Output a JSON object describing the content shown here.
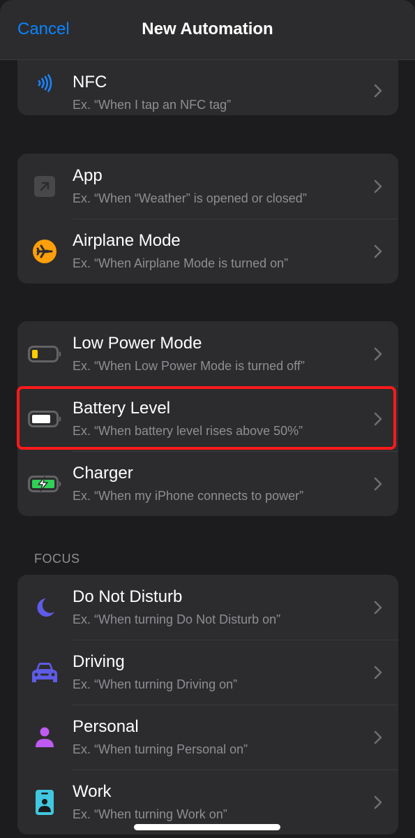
{
  "navbar": {
    "cancel_label": "Cancel",
    "title": "New Automation"
  },
  "colors": {
    "accent": "#0a84ff",
    "background": "#1c1c1e",
    "card": "#2c2c2e",
    "highlight_border": "#ff1a1a"
  },
  "groups": [
    {
      "items": [
        {
          "icon": "nfc-icon",
          "title": "NFC",
          "subtitle": "Ex. “When I tap an NFC tag”"
        }
      ]
    },
    {
      "items": [
        {
          "icon": "app-icon",
          "title": "App",
          "subtitle": "Ex. “When “Weather” is opened or closed”"
        },
        {
          "icon": "airplane-icon",
          "title": "Airplane Mode",
          "subtitle": "Ex. “When Airplane Mode is turned on”"
        }
      ]
    },
    {
      "items": [
        {
          "icon": "low-battery-icon",
          "title": "Low Power Mode",
          "subtitle": "Ex. “When Low Power Mode is turned off”"
        },
        {
          "icon": "battery-icon",
          "title": "Battery Level",
          "subtitle": "Ex. “When battery level rises above 50%”",
          "highlighted": true
        },
        {
          "icon": "charging-battery-icon",
          "title": "Charger",
          "subtitle": "Ex. “When my iPhone connects to power”"
        }
      ]
    },
    {
      "header": "FOCUS",
      "items": [
        {
          "icon": "moon-icon",
          "title": "Do Not Disturb",
          "subtitle": "Ex. “When turning Do Not Disturb on”"
        },
        {
          "icon": "car-icon",
          "title": "Driving",
          "subtitle": "Ex. “When turning Driving on”"
        },
        {
          "icon": "person-icon",
          "title": "Personal",
          "subtitle": "Ex. “When turning Personal on”"
        },
        {
          "icon": "id-badge-icon",
          "title": "Work",
          "subtitle": "Ex. “When turning Work on”"
        }
      ]
    }
  ]
}
